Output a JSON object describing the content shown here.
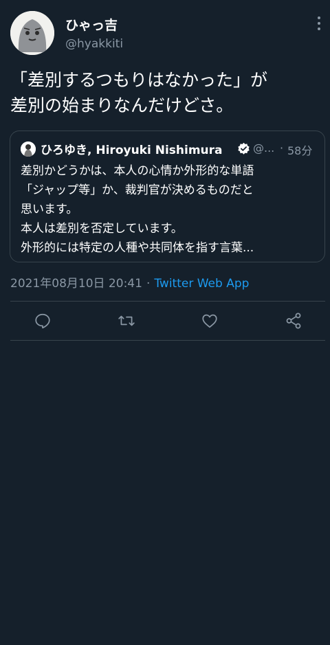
{
  "author": {
    "display_name": "ひゃっ吉",
    "handle": "@hyakkiti"
  },
  "tweet": {
    "text": "「差別するつもりはなかった」が\n差別の始まりなんだけどさ。"
  },
  "quoted_tweet": {
    "display_name": "ひろゆき, Hiroyuki Nishimura",
    "handle": "@...",
    "separator": "·",
    "time": "58分",
    "lines": [
      "差別かどうかは、本人の心情か外形的な単語",
      "「ジャップ等」か、裁判官が決めるものだと",
      "思います。",
      "本人は差別を否定しています。",
      "外形的には特定の人種や共同体を指す言葉..."
    ]
  },
  "meta": {
    "timestamp": "2021年08月10日 20:41",
    "separator": "·",
    "source": "Twitter Web App"
  },
  "actions": {
    "reply_icon": "reply-icon",
    "retweet_icon": "retweet-icon",
    "like_icon": "heart-icon",
    "share_icon": "share-icon"
  },
  "colors": {
    "background": "#15202b",
    "text": "#ffffff",
    "secondary_text": "#8b98a5",
    "link": "#1d9bf0",
    "border": "#38444d"
  }
}
